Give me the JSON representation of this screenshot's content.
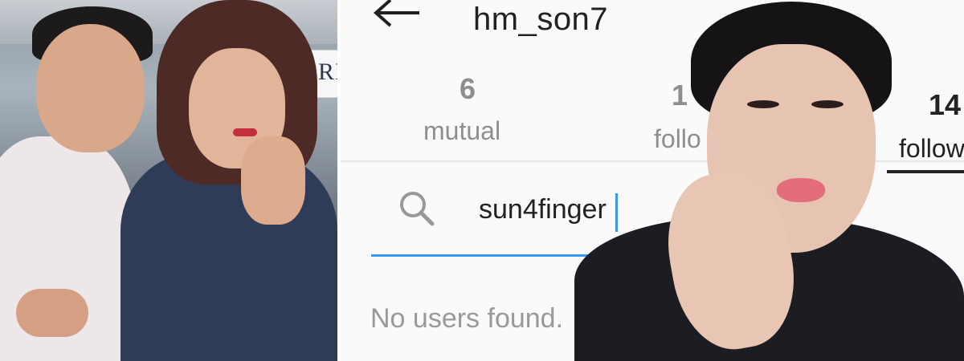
{
  "profile": {
    "username": "hm_son7",
    "stats": [
      {
        "value": "6",
        "label": "mutual"
      },
      {
        "value": "1",
        "label": "follo"
      },
      {
        "value": "14",
        "label": "follow"
      }
    ]
  },
  "search": {
    "query": "sun4finger",
    "empty_message": "No users found."
  },
  "photo": {
    "sign_text": "LORI"
  },
  "colors": {
    "accent": "#3897f0",
    "text": "#222222",
    "muted": "#8e8e8e"
  },
  "icons": {
    "back": "back-arrow-icon",
    "search": "search-icon"
  }
}
